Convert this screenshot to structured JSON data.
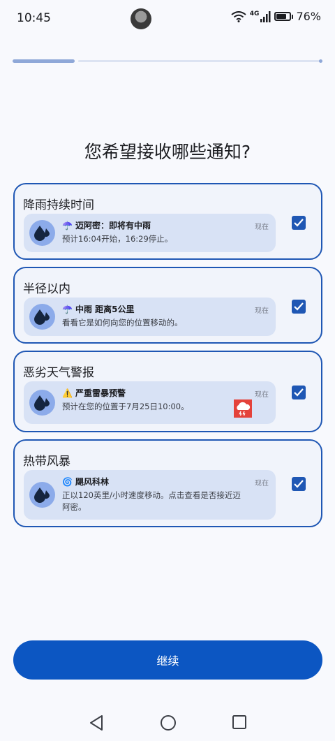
{
  "status_bar": {
    "time": "10:45",
    "network": "4G",
    "battery_percent": "76%",
    "battery_level": 0.76,
    "icons": [
      "avatar",
      "wifi-icon",
      "signal-icon",
      "battery-icon"
    ]
  },
  "progress": {
    "value": 0.2
  },
  "page_title": "您希望接收哪些通知?",
  "options": [
    {
      "title": "降雨持续时间",
      "checked": true,
      "notification": {
        "emoji": "☂️",
        "headline": "迈阿密：即将有中雨",
        "time": "现在",
        "body": "预计16:04开始，16:29停止。"
      }
    },
    {
      "title": "半径以内",
      "checked": true,
      "notification": {
        "emoji": "☂️",
        "headline": "中雨 距离5公里",
        "time": "现在",
        "body": "看看它是如何向您的位置移动的。"
      }
    },
    {
      "title": "恶劣天气警报",
      "checked": true,
      "notification": {
        "emoji": "⚠️",
        "headline": "严重雷暴预警",
        "time": "现在",
        "body": "预计在您的位置于7月25日10:00。"
      }
    },
    {
      "title": "热带风暴",
      "checked": true,
      "notification": {
        "emoji": "🌀",
        "headline": "飓风科林",
        "time": "现在",
        "body": "正以120英里/小时速度移动。点击查看是否接近迈阿密。"
      }
    }
  ],
  "continue_label": "继续",
  "nav_bar": {
    "icons": [
      "back-icon",
      "home-icon",
      "recents-icon"
    ]
  },
  "colors": {
    "accent": "#1f57b4",
    "button": "#0c56c2",
    "card_bg": "#f1f4fb",
    "notification_bg": "#d8e2f5",
    "icon_bg": "#8cabea"
  }
}
